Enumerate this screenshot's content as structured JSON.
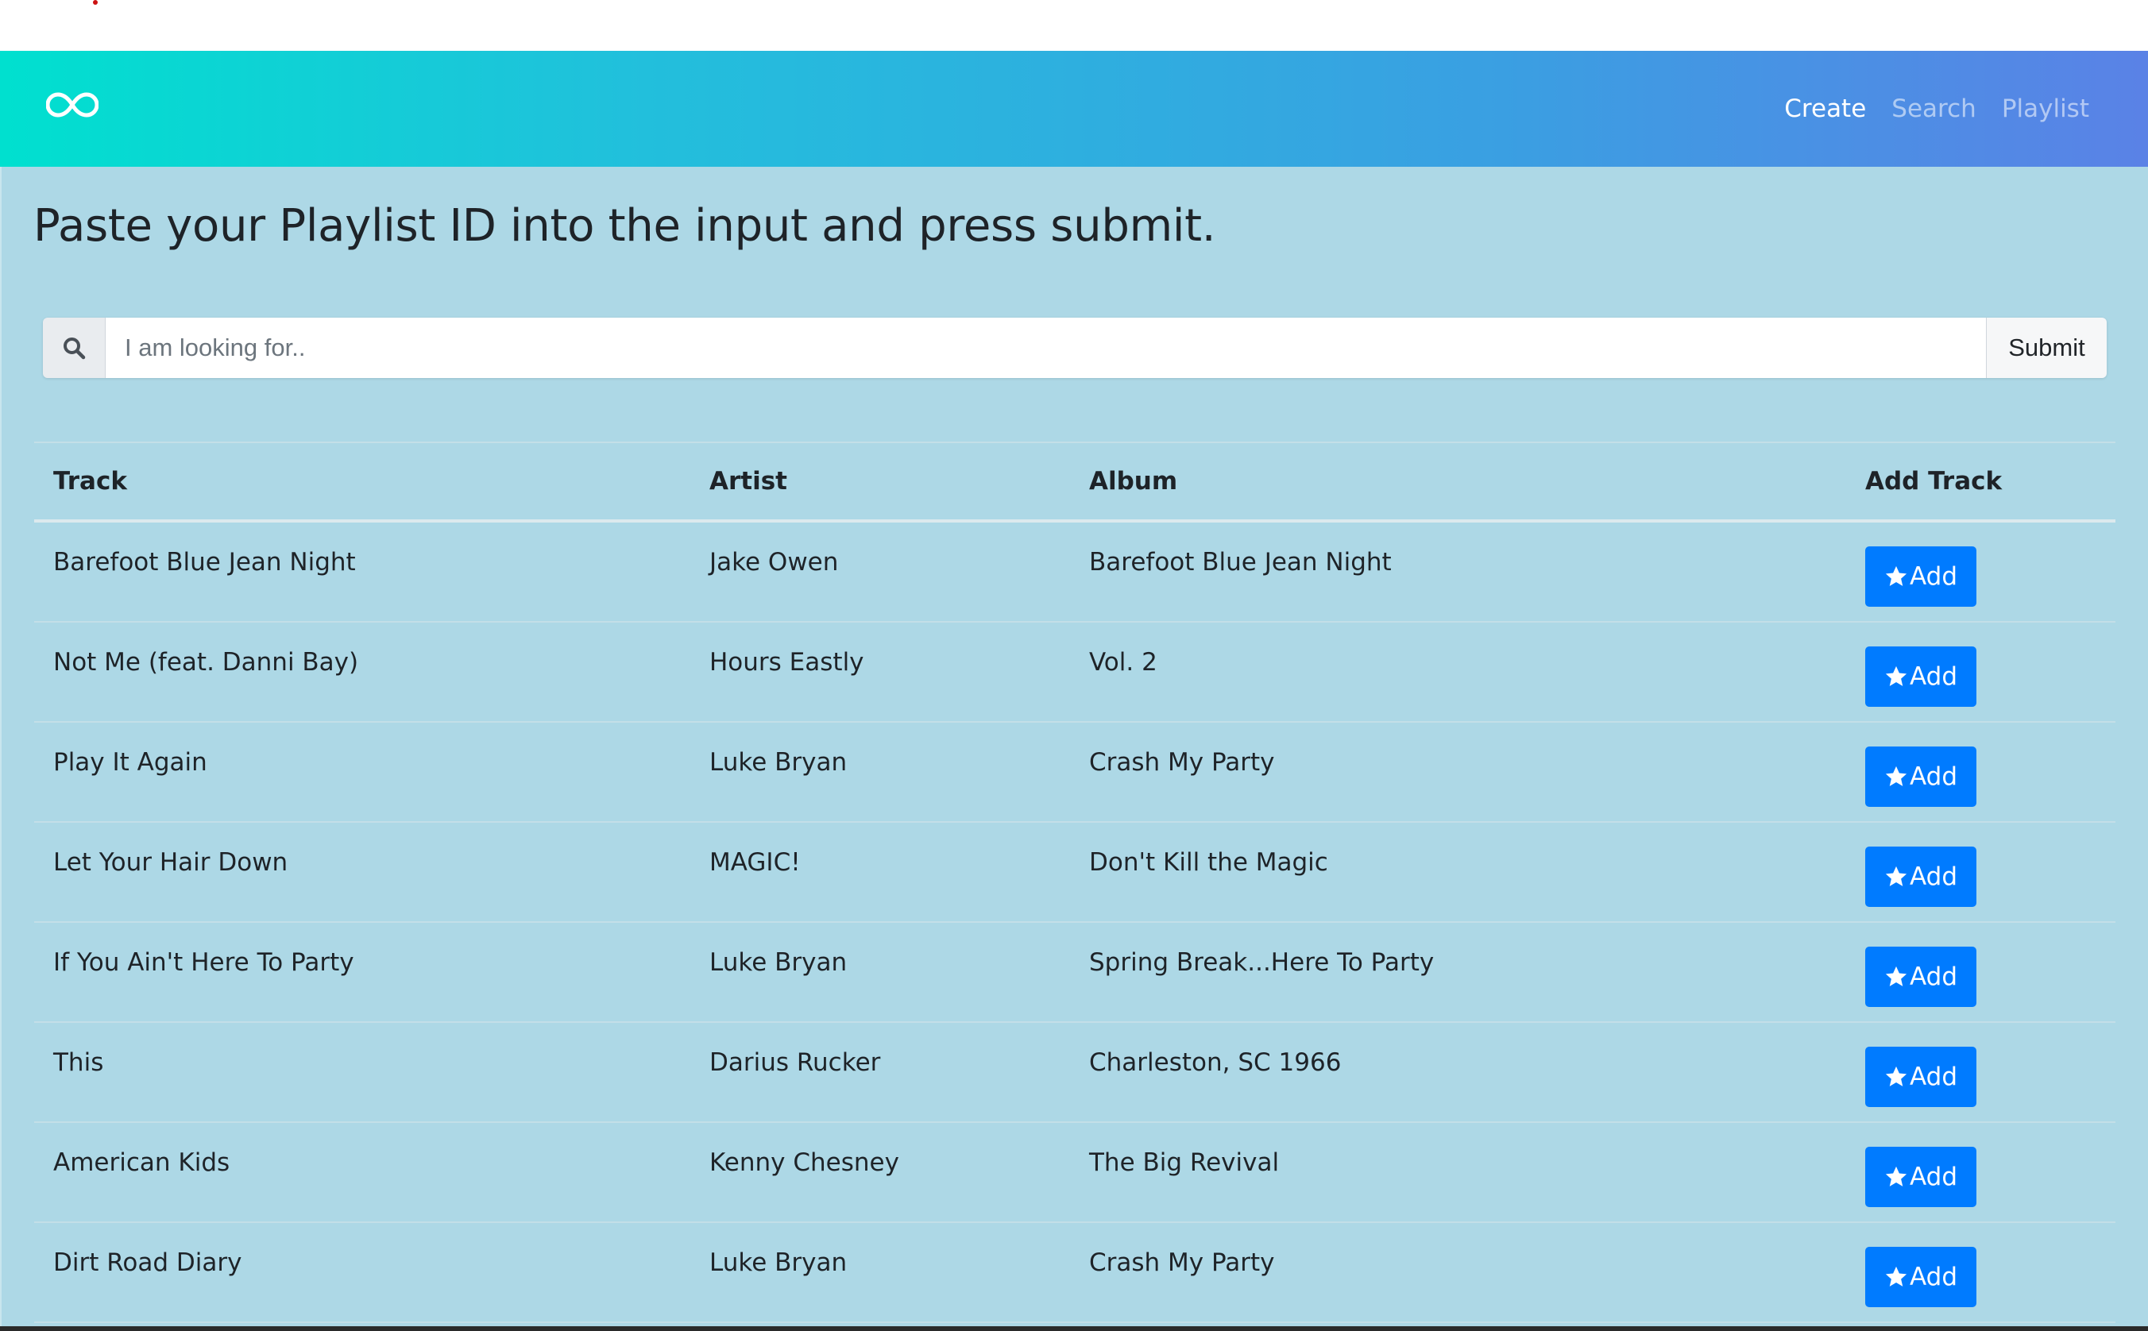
{
  "nav": {
    "brand_icon": "infinity-icon",
    "links": [
      "Create",
      "Search",
      "Playlist"
    ],
    "active": "Create"
  },
  "page": {
    "heading": "Paste your Playlist ID into the input and press submit."
  },
  "search": {
    "icon": "search-icon",
    "placeholder": "I am looking for..",
    "value": "",
    "submit_label": "Submit"
  },
  "table": {
    "headers": [
      "Track",
      "Artist",
      "Album",
      "Add Track"
    ],
    "rows": [
      {
        "track": "Barefoot Blue Jean Night",
        "artist": "Jake Owen",
        "album": "Barefoot Blue Jean Night",
        "button": "Add"
      },
      {
        "track": "Not Me (feat. Danni Bay)",
        "artist": "Hours Eastly",
        "album": "Vol. 2",
        "button": "Add"
      },
      {
        "track": "Play It Again",
        "artist": "Luke Bryan",
        "album": "Crash My Party",
        "button": "Add"
      },
      {
        "track": "Let Your Hair Down",
        "artist": "MAGIC!",
        "album": "Don't Kill the Magic",
        "button": "Add"
      },
      {
        "track": "If You Ain't Here To Party",
        "artist": "Luke Bryan",
        "album": "Spring Break...Here To Party",
        "button": "Add"
      },
      {
        "track": "This",
        "artist": "Darius Rucker",
        "album": "Charleston, SC 1966",
        "button": "Add"
      },
      {
        "track": "American Kids",
        "artist": "Kenny Chesney",
        "album": "The Big Revival",
        "button": "Add"
      },
      {
        "track": "Dirt Road Diary",
        "artist": "Luke Bryan",
        "album": "Crash My Party",
        "button": "Add"
      }
    ],
    "button_icon": "star-icon"
  },
  "colors": {
    "navbar_start": "#00e0cf",
    "navbar_end": "#5a82e6",
    "page_background": "#add8e6",
    "button": "#007bff"
  }
}
